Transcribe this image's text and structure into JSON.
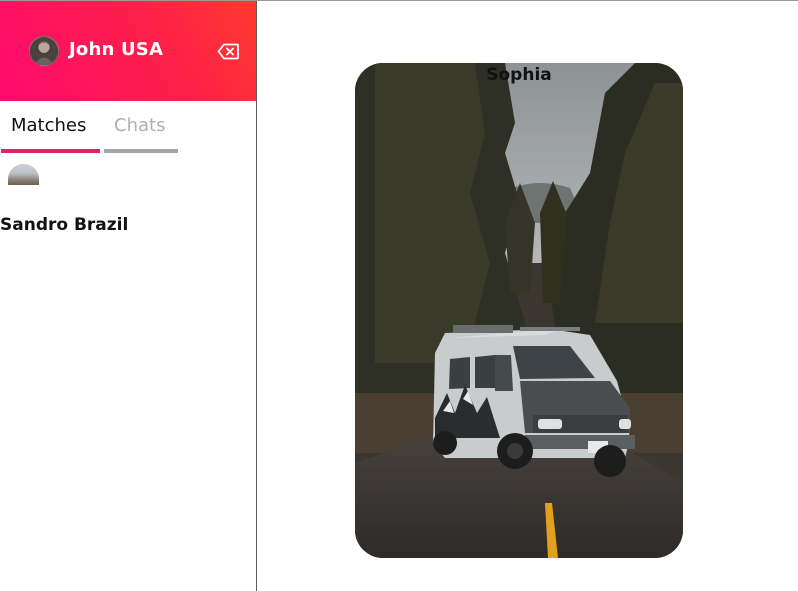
{
  "header": {
    "user_name": "John USA",
    "avatar_icon": "user-avatar",
    "logout_icon": "backspace-icon",
    "gradient_start": "#fe0a6e",
    "gradient_end": "#fe3a2e"
  },
  "tabs": [
    {
      "label": "Matches",
      "active": true,
      "underline_color": "#ec1d6a"
    },
    {
      "label": "Chats",
      "active": false,
      "underline_color": "#a6a6a6"
    }
  ],
  "matches": [
    {
      "name": "Sandro Brazil",
      "thumb_icon": "match-avatar"
    }
  ],
  "card": {
    "name": "Sophia",
    "image_description_icon": "van-in-forest-photo"
  }
}
